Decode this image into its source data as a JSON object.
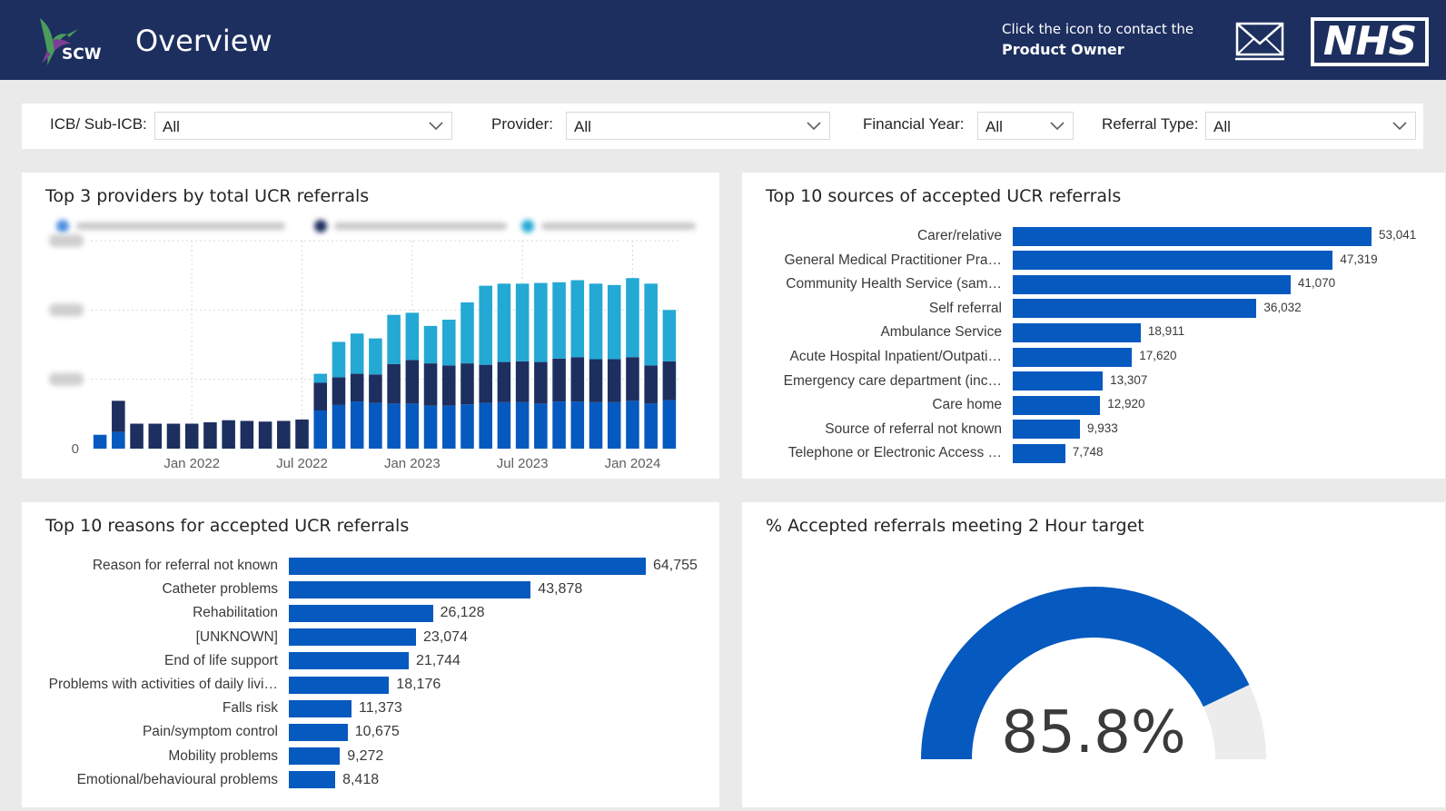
{
  "header": {
    "logo_text": "SCW",
    "title": "Overview",
    "contact_line1": "Click the icon to contact the",
    "contact_line2": "Product Owner",
    "mail_icon": "envelope-icon",
    "nhs_logo_text": "NHS",
    "colors": {
      "bar": "#1d2f5f",
      "text": "#ffffff"
    }
  },
  "filters": [
    {
      "label": "ICB/ Sub-ICB:",
      "value": "All"
    },
    {
      "label": "Provider:",
      "value": "All"
    },
    {
      "label": "Financial Year:",
      "value": "All"
    },
    {
      "label": "Referral Type:",
      "value": "All"
    }
  ],
  "cards": {
    "providers": {
      "title": "Top 3 providers by total UCR referrals"
    },
    "sources": {
      "title": "Top 10 sources of accepted UCR referrals"
    },
    "reasons": {
      "title": "Top 10 reasons for accepted UCR referrals"
    },
    "gauge": {
      "title": "% Accepted referrals meeting 2 Hour target"
    }
  },
  "chart_data": [
    {
      "id": "providers",
      "type": "bar",
      "stacked": true,
      "title": "Top 3 providers by total UCR referrals",
      "legend": "top, obscured",
      "y_tick_labels": [
        "0"
      ],
      "x_tick_labels": [
        "Jan 2022",
        "Jul 2022",
        "Jan 2023",
        "Jul 2023",
        "Jan 2024"
      ],
      "ylim": [
        0,
        3000
      ],
      "grid": true,
      "months": 32,
      "series": [
        {
          "color": "#0659bf",
          "values": [
            200,
            240,
            0,
            0,
            0,
            0,
            0,
            0,
            0,
            0,
            0,
            0,
            550,
            630,
            680,
            660,
            650,
            650,
            620,
            620,
            640,
            660,
            670,
            670,
            650,
            680,
            680,
            670,
            670,
            690,
            650,
            700
          ]
        },
        {
          "color": "#1d2f5f",
          "values": [
            0,
            450,
            360,
            360,
            360,
            360,
            380,
            410,
            400,
            390,
            400,
            420,
            400,
            400,
            400,
            410,
            570,
            630,
            610,
            580,
            590,
            550,
            580,
            590,
            600,
            620,
            640,
            620,
            620,
            630,
            550,
            560
          ]
        },
        {
          "color": "#24a8d4",
          "values": [
            0,
            0,
            0,
            0,
            0,
            0,
            0,
            0,
            0,
            0,
            0,
            0,
            130,
            510,
            580,
            520,
            710,
            680,
            540,
            660,
            880,
            1140,
            1130,
            1120,
            1140,
            1100,
            1110,
            1090,
            1070,
            1140,
            1180,
            740
          ]
        }
      ]
    },
    {
      "id": "sources",
      "type": "bar",
      "orientation": "horizontal",
      "title": "Top 10 sources of accepted UCR referrals",
      "color": "#0659bf",
      "categories": [
        "Carer/relative",
        "General Medical Practitioner Pra…",
        "Community Health Service (sam…",
        "Self referral",
        "Ambulance Service",
        "Acute Hospital Inpatient/Outpati…",
        "Emergency care department (inc…",
        "Care home",
        "Source of referral not known",
        "Telephone or Electronic Access …"
      ],
      "values": [
        53041,
        47319,
        41070,
        36032,
        18911,
        17620,
        13307,
        12920,
        9933,
        7748
      ],
      "labels": [
        "53,041",
        "47,319",
        "41,070",
        "36,032",
        "18,911",
        "17,620",
        "13,307",
        "12,920",
        "9,933",
        "7,748"
      ]
    },
    {
      "id": "reasons",
      "type": "bar",
      "orientation": "horizontal",
      "title": "Top 10 reasons for accepted UCR referrals",
      "color": "#0659bf",
      "categories": [
        "Reason for referral not known",
        "Catheter problems",
        "Rehabilitation",
        "[UNKNOWN]",
        "End of life support",
        "Problems with activities of daily livi…",
        "Falls risk",
        "Pain/symptom control",
        "Mobility problems",
        "Emotional/behavioural problems"
      ],
      "values": [
        64755,
        43878,
        26128,
        23074,
        21744,
        18176,
        11373,
        10675,
        9272,
        8418
      ],
      "labels": [
        "64,755",
        "43,878",
        "26,128",
        "23,074",
        "21,744",
        "18,176",
        "11,373",
        "10,675",
        "9,272",
        "8,418"
      ]
    },
    {
      "id": "gauge",
      "type": "gauge",
      "title": "% Accepted referrals meeting 2 Hour target",
      "value": 85.8,
      "max": 100,
      "label": "85.8%",
      "colors": {
        "fill": "#0659bf",
        "track": "#ececec"
      }
    }
  ]
}
